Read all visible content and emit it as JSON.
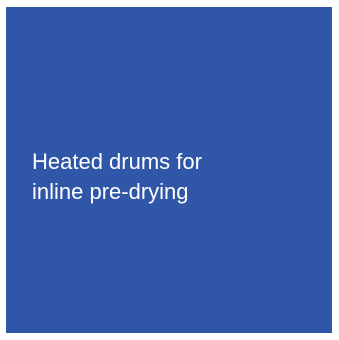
{
  "tile": {
    "color": "#2f56a7",
    "text_color": "#ffffff",
    "lines": [
      "Heated drums for",
      "inline pre-drying"
    ]
  }
}
